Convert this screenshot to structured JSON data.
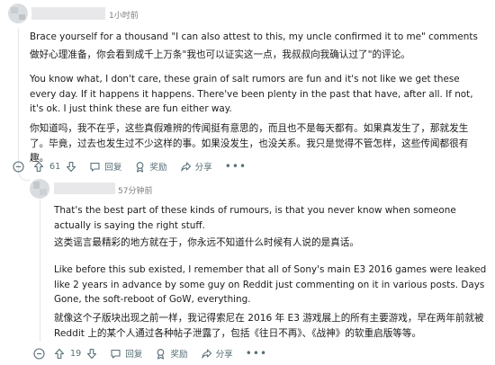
{
  "comment1": {
    "time": "1小时前",
    "paragraphs": [
      "Brace yourself for a thousand \"I can also attest to this, my uncle confirmed it to me\" comments",
      "做好心理准备，你会看到成千上万条\"我也可以证实这一点，我叔叔向我确认过了\"的评论。",
      "You know what, I don't care, these grain of salt rumors are fun and it's not like we get these every day. If it happens it happens. There've been plenty in the past that have, after all. If not, it's ok. I just think these are fun either way.",
      "你知道吗，我不在乎，这些真假难辨的传闻挺有意思的，而且也不是每天都有。如果真发生了，那就发生了。毕竟，过去也发生过不少这样的事。如果没发生，也没关系。我只是觉得不管怎样，这些传闻都很有趣。"
    ],
    "actions": {
      "votes": "61",
      "reply": "回复",
      "award": "奖励",
      "share": "分享",
      "more": "•••"
    }
  },
  "comment2": {
    "time": "57分钟前",
    "paragraphs": [
      "That's the best part of these kinds of rumours, is that you never know when someone actually is saying the right stuff.",
      "这类谣言最精彩的地方就在于，你永远不知道什么时候有人说的是真话。",
      "Like before this sub existed, I remember that all of Sony's main E3 2016 games were leaked like 2 years in advance by some guy on Reddit just commenting on it in various posts. Days Gone, the soft-reboot of GoW, everything.",
      "就像这个子版块出现之前一样，我记得索尼在 2016 年 E3 游戏展上的所有主要游戏，早在两年前就被 Reddit 上的某个人通过各种帖子泄露了，包括《往日不再》、《战神》的软重启版等等。"
    ],
    "actions": {
      "votes": "19",
      "reply": "回复",
      "award": "奖励",
      "share": "分享",
      "more": "•••"
    }
  },
  "colors": {
    "action_text": "#576f76",
    "meta_text": "#7c7c7c",
    "thread_line": "#e3e6e8"
  }
}
